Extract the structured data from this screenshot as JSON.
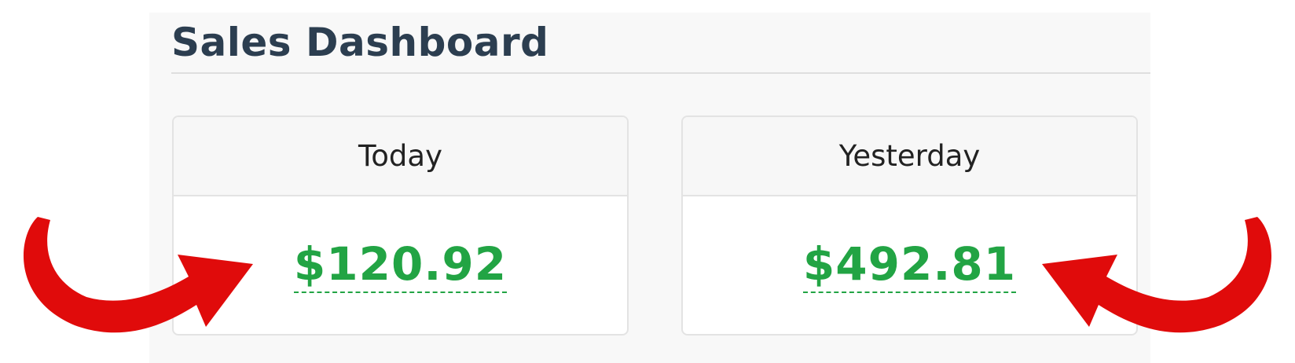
{
  "dashboard": {
    "title": "Sales Dashboard"
  },
  "cards": [
    {
      "label": "Today",
      "value": "$120.92"
    },
    {
      "label": "Yesterday",
      "value": "$492.81"
    }
  ],
  "colors": {
    "title": "#2c3e50",
    "value": "#22a444",
    "arrow": "#e00b0b"
  }
}
